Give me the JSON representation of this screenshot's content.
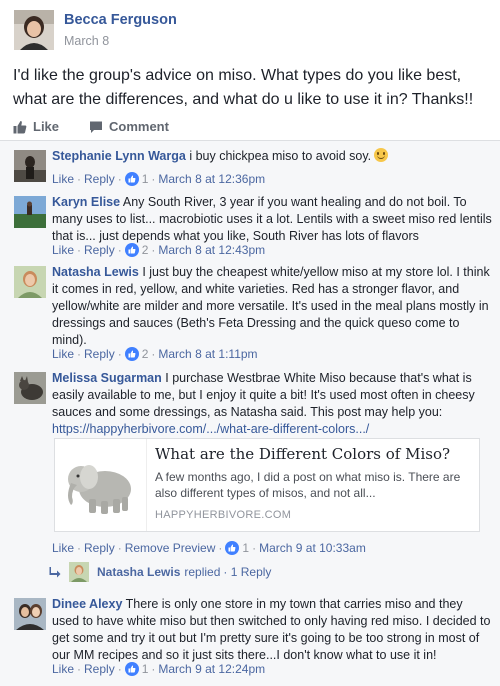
{
  "post": {
    "author": "Becca Ferguson",
    "date": "March 8",
    "text": "I'd like the group's advice on miso. What types do you like best, what are the differences, and what do u like to use it in? Thanks!!",
    "actions": {
      "like": "Like",
      "comment": "Comment"
    }
  },
  "labels": {
    "like": "Like",
    "reply": "Reply",
    "remove_preview": "Remove Preview"
  },
  "comments": [
    {
      "author": "Stephanie Lynn Warga",
      "text": "i buy chickpea miso to avoid soy.",
      "reactions": "1",
      "time": "March 8 at 12:36pm"
    },
    {
      "author": "Karyn Elise",
      "text": "Any South River, 3 year if you want healing and do not boil. To many uses to list... macrobiotic uses it a lot. Lentils with a sweet miso red lentils that is... just depends what you like, South River has lots of flavors",
      "reactions": "2",
      "time": "March 8 at 12:43pm"
    },
    {
      "author": "Natasha Lewis",
      "text": "I just buy the cheapest white/yellow miso at my store lol. I think it comes in red, yellow, and white varieties. Red has a stronger flavor, and yellow/white are milder and more versatile. It's used in the meal plans mostly in dressings and sauces (Beth's Feta Dressing and the quick queso come to mind).",
      "reactions": "2",
      "time": "March 8 at 1:11pm"
    },
    {
      "author": "Melissa Sugarman",
      "text": "I purchase Westbrae White Miso because that's what is easily available to me, but I enjoy it quite a bit! It's used most often in cheesy sauces and some dressings, as Natasha said. This post may help you:",
      "link": "https://happyherbivore.com/.../what-are-different-colors.../",
      "reactions": "1",
      "time": "March 9 at 10:33am"
    },
    {
      "author": "Dinee Alexy",
      "text": "There is only one store in my town that carries miso and they used to have white miso but then switched to only having red miso. I decided to get some and try it out but I'm pretty sure it's going to be too strong in most of our MM recipes and so it just sits there...I don't know what to use it in!",
      "reactions": "1",
      "time": "March 9 at 12:24pm"
    }
  ],
  "link_preview": {
    "title": "What are the Different Colors of Miso?",
    "description": "A few months ago, I did a post on what miso is. There are also different types of misos, and not all...",
    "domain": "HAPPYHERBIVORE.COM"
  },
  "reply": {
    "name": "Natasha Lewis",
    "text": "replied",
    "count": "· 1 Reply"
  },
  "colors": {
    "link": "#365899",
    "meta": "#90949c",
    "reaction": "#4080ff",
    "background": "#f6f7f9"
  }
}
